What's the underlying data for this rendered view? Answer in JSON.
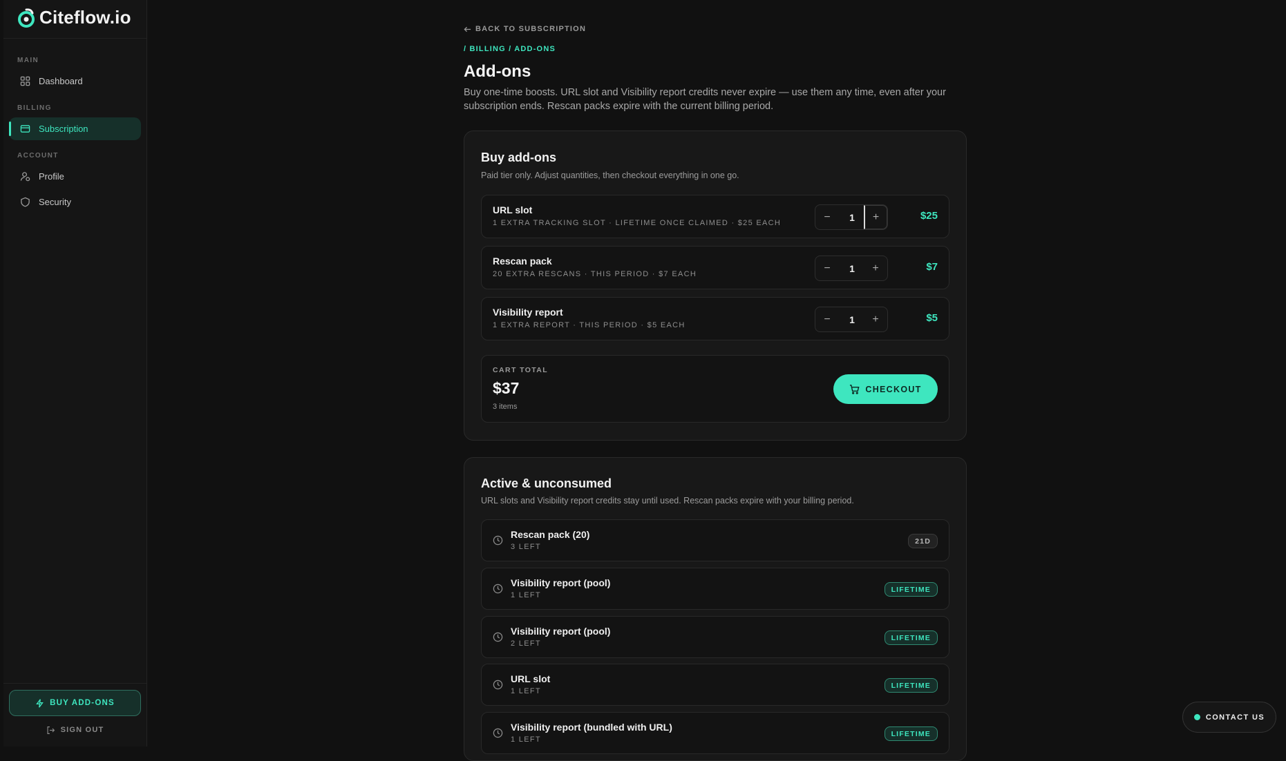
{
  "brand": {
    "name": "Citeflow.io",
    "accent": "#3ee6bf"
  },
  "sidebar": {
    "sections": [
      {
        "label": "MAIN",
        "items": [
          {
            "label": "Dashboard",
            "icon": "grid-icon"
          }
        ]
      },
      {
        "label": "BILLING",
        "items": [
          {
            "label": "Subscription",
            "icon": "credit-card-icon",
            "active": true
          }
        ]
      },
      {
        "label": "ACCOUNT",
        "items": [
          {
            "label": "Profile",
            "icon": "user-icon"
          },
          {
            "label": "Security",
            "icon": "shield-icon"
          }
        ]
      }
    ],
    "buy_addons": "BUY ADD-ONS",
    "sign_out": "SIGN OUT"
  },
  "main": {
    "back": "BACK TO SUBSCRIPTION",
    "breadcrumb": "/ BILLING / ADD-ONS",
    "title": "Add-ons",
    "description": "Buy one-time boosts. URL slot and Visibility report credits never expire — use them any time, even after your subscription ends. Rescan packs expire with the current billing period."
  },
  "buy": {
    "title": "Buy add-ons",
    "subtitle": "Paid tier only. Adjust quantities, then checkout everything in one go.",
    "items": [
      {
        "name": "URL slot",
        "meta": "1 EXTRA TRACKING SLOT · LIFETIME ONCE CLAIMED · $25 EACH",
        "qty": "1",
        "price": "$25"
      },
      {
        "name": "Rescan pack",
        "meta": "20 EXTRA RESCANS · THIS PERIOD · $7 EACH",
        "qty": "1",
        "price": "$7"
      },
      {
        "name": "Visibility report",
        "meta": "1 EXTRA REPORT · THIS PERIOD · $5 EACH",
        "qty": "1",
        "price": "$5"
      }
    ],
    "cart": {
      "label": "CART TOTAL",
      "total": "$37",
      "items": "3 items",
      "checkout": "CHECKOUT"
    }
  },
  "active": {
    "title": "Active & unconsumed",
    "subtitle": "URL slots and Visibility report credits stay until used. Rescan packs expire with your billing period.",
    "items": [
      {
        "name": "Rescan pack (20)",
        "meta": "3 LEFT",
        "badge": "21D",
        "badge_type": "days"
      },
      {
        "name": "Visibility report (pool)",
        "meta": "1 LEFT",
        "badge": "LIFETIME",
        "badge_type": "lifetime"
      },
      {
        "name": "Visibility report (pool)",
        "meta": "2 LEFT",
        "badge": "LIFETIME",
        "badge_type": "lifetime"
      },
      {
        "name": "URL slot",
        "meta": "1 LEFT",
        "badge": "LIFETIME",
        "badge_type": "lifetime"
      },
      {
        "name": "Visibility report (bundled with URL)",
        "meta": "1 LEFT",
        "badge": "LIFETIME",
        "badge_type": "lifetime"
      }
    ]
  },
  "contact": "CONTACT US"
}
